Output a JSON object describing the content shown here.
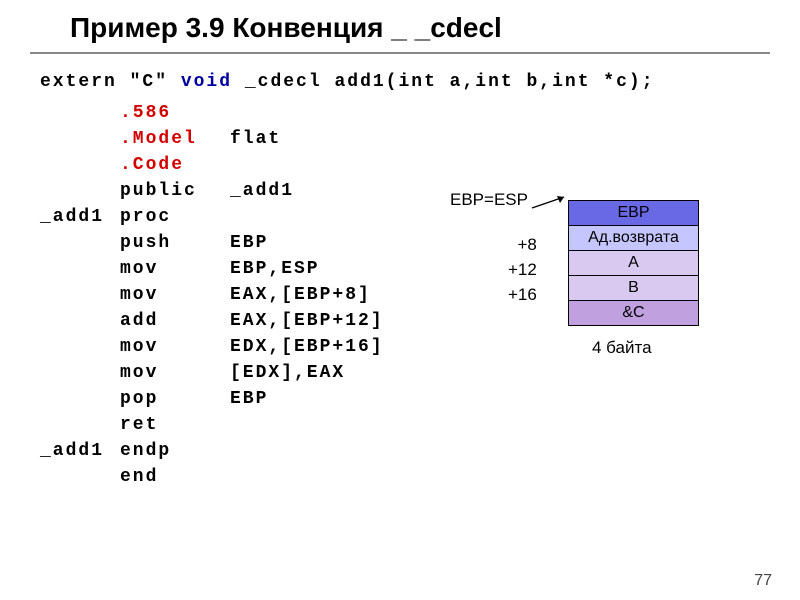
{
  "title": "Пример 3.9 Конвенция _ _cdecl",
  "declaration": {
    "part1": "extern \"C\" ",
    "kw": "void",
    "part2": " _cdecl add1(int a,int b,int *c);"
  },
  "code": [
    {
      "lbl": "",
      "op": ".586",
      "arg": "",
      "red_op": true
    },
    {
      "lbl": "",
      "op": ".Model",
      "arg": "flat",
      "red_op": true
    },
    {
      "lbl": "",
      "op": ".Code",
      "arg": "",
      "red_op": true
    },
    {
      "lbl": "",
      "op": "public",
      "arg": "_add1",
      "red_op": false
    },
    {
      "lbl": "_add1",
      "op": "proc",
      "arg": "",
      "red_op": false
    },
    {
      "lbl": "",
      "op": "push",
      "arg": "EBP",
      "red_op": false
    },
    {
      "lbl": "",
      "op": "mov",
      "arg": "EBP,ESP",
      "red_op": false
    },
    {
      "lbl": "",
      "op": "mov",
      "arg": "EAX,[EBP+8]",
      "red_op": false
    },
    {
      "lbl": "",
      "op": "add",
      "arg": "EAX,[EBP+12]",
      "red_op": false
    },
    {
      "lbl": "",
      "op": "mov",
      "arg": "EDX,[EBP+16]",
      "red_op": false
    },
    {
      "lbl": "",
      "op": "mov",
      "arg": "[EDX],EAX",
      "red_op": false
    },
    {
      "lbl": "",
      "op": "pop",
      "arg": "EBP",
      "red_op": false
    },
    {
      "lbl": "",
      "op": "ret",
      "arg": "",
      "red_op": false
    },
    {
      "lbl": "_add1",
      "op": "endp",
      "arg": "",
      "red_op": false
    },
    {
      "lbl": "",
      "op": "end",
      "arg": "",
      "red_op": false
    }
  ],
  "diagram": {
    "label_ebp_esp": "EBP=ESP",
    "offsets": [
      "+8",
      "+12",
      "+16"
    ],
    "rows": [
      "EBP",
      "Ад.возврата",
      "A",
      "B",
      "&C"
    ],
    "bytes": "4 байта"
  },
  "pagenum": "77"
}
